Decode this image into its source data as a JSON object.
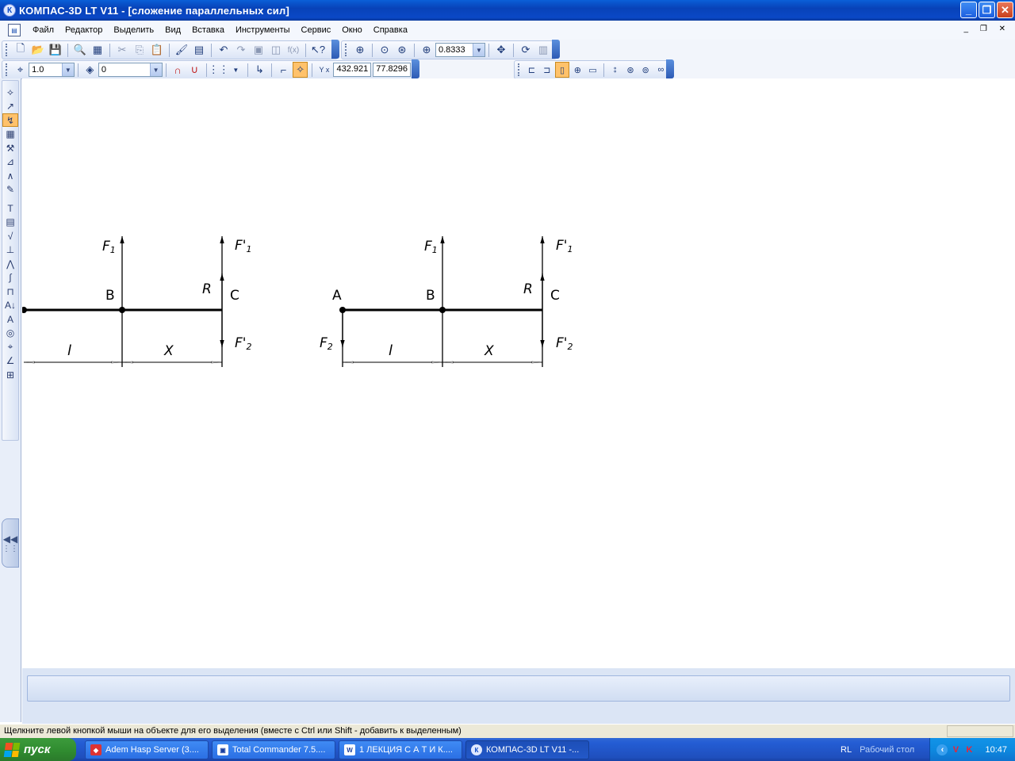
{
  "window": {
    "title": "КОМПАС-3D LT V11 - [сложение параллельных сил]",
    "app_icon": "kompas-logo",
    "minimize": "_",
    "restore": "❐",
    "close": "✕"
  },
  "menu": {
    "items": [
      "Файл",
      "Редактор",
      "Выделить",
      "Вид",
      "Вставка",
      "Инструменты",
      "Сервис",
      "Окно",
      "Справка"
    ],
    "mdi_controls": "_ ❐ ✕"
  },
  "toolbar_standard": {
    "icons": [
      "new-icon",
      "open-icon",
      "save-icon",
      "print-preview-icon",
      "manager-icon",
      "cut-icon",
      "copy-icon",
      "paste-icon",
      "brush-icon",
      "properties-icon",
      "undo-icon",
      "redo-icon",
      "insert-object-icon",
      "object-icon",
      "variables-icon",
      "help-pointer-icon"
    ],
    "variables_label": "f(x)"
  },
  "toolbar_view": {
    "zoom_value": "0.8333",
    "icons": [
      "zoom-window-icon",
      "zoom-dynamic-icon",
      "zoom-extent-icon",
      "zoom-in-icon",
      "pan-icon",
      "refresh-icon",
      "layers-icon"
    ]
  },
  "toolbar_current_state": {
    "scale_value": "1.0",
    "layer_value": "0",
    "coord_x": "432.921",
    "coord_y": "77.8296",
    "coord_label": "Y x"
  },
  "toolbar_format": {
    "icons": [
      "align-left-icon",
      "align-center-icon",
      "align-active-icon",
      "target-icon",
      "minus-icon",
      "spec-icon",
      "globe-icon",
      "layers-round-icon",
      "wave-icon"
    ]
  },
  "left_panel": {
    "icons": [
      "geometry-icon",
      "dimension-icon",
      "curves-icon",
      "grid-icon",
      "hammer-icon",
      "segments-icon",
      "angle-icon",
      "edit-icon",
      "text-icon",
      "table-icon",
      "check-icon",
      "stamp-icon",
      "polyline-icon",
      "spline-icon",
      "frame-icon",
      "level-icon",
      "text-A-icon",
      "circle-icon",
      "crosshair-icon",
      "measure-icon",
      "spec-icon"
    ],
    "collapse_label": "◀◀"
  },
  "drawing": {
    "left_figure": {
      "labels": {
        "f1": "F",
        "f1_sub": "1",
        "f1p": "F'",
        "f1p_sub": "1",
        "b": "B",
        "r": "R",
        "c": "C",
        "f2p": "F'",
        "f2p_sub": "2",
        "l": "l",
        "x": "X"
      }
    },
    "right_figure": {
      "labels": {
        "f1": "F",
        "f1_sub": "1",
        "f1p": "F'",
        "f1p_sub": "1",
        "a": "A",
        "b": "B",
        "r": "R",
        "c": "C",
        "f2": "F",
        "f2_sub": "2",
        "f2p": "F'",
        "f2p_sub": "2",
        "l": "l",
        "x": "X"
      }
    }
  },
  "status": {
    "text": "Щелкните левой кнопкой мыши на объекте для его выделения (вместе с Ctrl или Shift - добавить к выделенным)"
  },
  "taskbar": {
    "start_label": "пуск",
    "tasks": [
      {
        "label": "Adem Hasp Server (3....",
        "icon": "hasp-icon"
      },
      {
        "label": "Total Commander 7.5....",
        "icon": "total-commander-icon"
      },
      {
        "label": "1  ЛЕКЦИЯ С А Т И К....",
        "icon": "word-icon"
      },
      {
        "label": "КОМПАС-3D LT V11 -...",
        "icon": "kompas-icon"
      }
    ],
    "lang": "RL",
    "desktop": "Рабочий стол",
    "clock": "10:47"
  },
  "colors": {
    "titlebar": "#0a48c6",
    "active_tool": "#ffc26b",
    "start_green": "#2f8a2f",
    "taskbar_blue": "#245dd4"
  }
}
